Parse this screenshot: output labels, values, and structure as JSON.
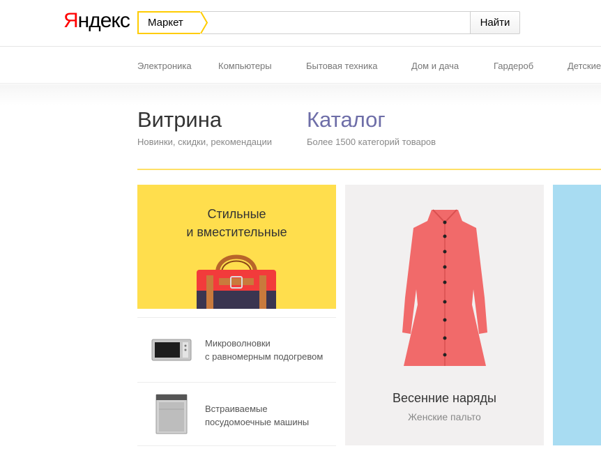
{
  "header": {
    "logo_first": "Я",
    "logo_rest": "ндекс",
    "search_tag": "Маркет",
    "search_value": "",
    "search_button": "Найти"
  },
  "nav": {
    "items": [
      {
        "label": "Электроника"
      },
      {
        "label": "Компьютеры"
      },
      {
        "label": "Бытовая техника"
      },
      {
        "label": "Дом и дача"
      },
      {
        "label": "Гардероб"
      },
      {
        "label": "Детские"
      }
    ]
  },
  "tabs": [
    {
      "title": "Витрина",
      "subtitle": "Новинки, скидки, рекомендации"
    },
    {
      "title": "Каталог",
      "subtitle": "Более 1500 категорий товаров"
    }
  ],
  "cards": {
    "bag": {
      "line1": "Стильные",
      "line2": "и вместительные"
    },
    "coat": {
      "title": "Весенние наряды",
      "subtitle": "Женские пальто"
    },
    "list": [
      {
        "line1": "Микроволновки",
        "line2": "с равномерным подогревом",
        "icon": "microwave-icon"
      },
      {
        "line1": "Встраиваемые",
        "line2": "посудомоечные машины",
        "icon": "dishwasher-icon"
      }
    ]
  },
  "colors": {
    "accent_yellow": "#ffcc00",
    "logo_red": "#ff0000",
    "catalog_link": "#6e6ea8",
    "bag_bg": "#ffde4d",
    "coat": "#f16a6a",
    "blue_card": "#a8dcf2"
  }
}
